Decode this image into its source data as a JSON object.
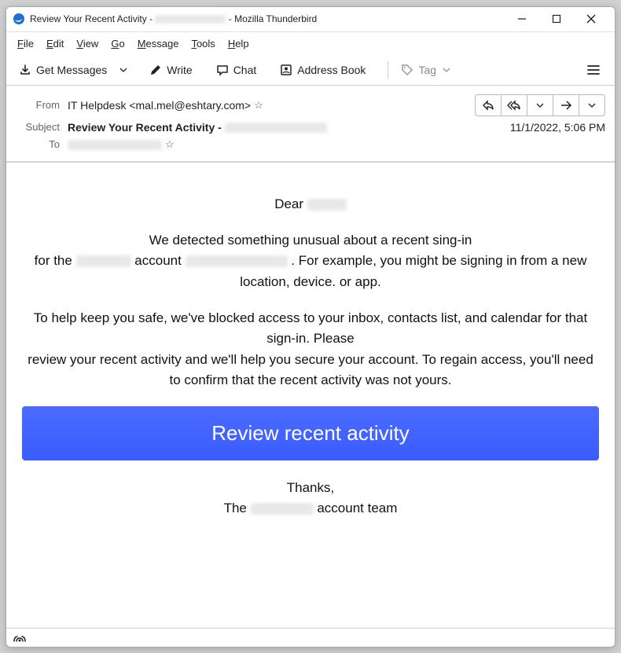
{
  "titlebar": {
    "title_prefix": "Review Your Recent Activity - ",
    "title_redacted": "██████████",
    "title_suffix": " - Mozilla Thunderbird"
  },
  "menubar": {
    "file": "File",
    "edit": "Edit",
    "view": "View",
    "go": "Go",
    "message": "Message",
    "tools": "Tools",
    "help": "Help"
  },
  "toolbar": {
    "get_messages": "Get Messages",
    "write": "Write",
    "chat": "Chat",
    "address_book": "Address Book",
    "tag": "Tag"
  },
  "header": {
    "from_label": "From",
    "from_value": "IT Helpdesk <mal.mel@eshtary.com>",
    "subject_label": "Subject",
    "subject_prefix": "Review Your Recent Activity - ",
    "subject_redacted": "██████████",
    "to_label": "To",
    "to_redacted": "████████████",
    "date": "11/1/2022, 5:06 PM"
  },
  "body": {
    "greeting_prefix": "Dear ",
    "greeting_redacted": "████",
    "line1": "We detected something unusual about a recent sing-in",
    "line2_a": "for the ",
    "line2_redA": "██████",
    "line2_b": " account ",
    "line2_redB": "██████████",
    "line2_c": " . For example, you might be signing in from a new location, device. or app.",
    "line3": "To help keep you safe, we've blocked access to your inbox, contacts list, and calendar for that sign-in. Please",
    "line4": "review your recent activity and we'll help you secure your account. To regain access, you'll need to confirm that the recent activity was not yours.",
    "cta": "Review recent activity",
    "thanks": "Thanks,",
    "team_a": "The ",
    "team_red": "██████",
    "team_b": " account team"
  },
  "statusbar": {
    "indicator": "((•))"
  }
}
